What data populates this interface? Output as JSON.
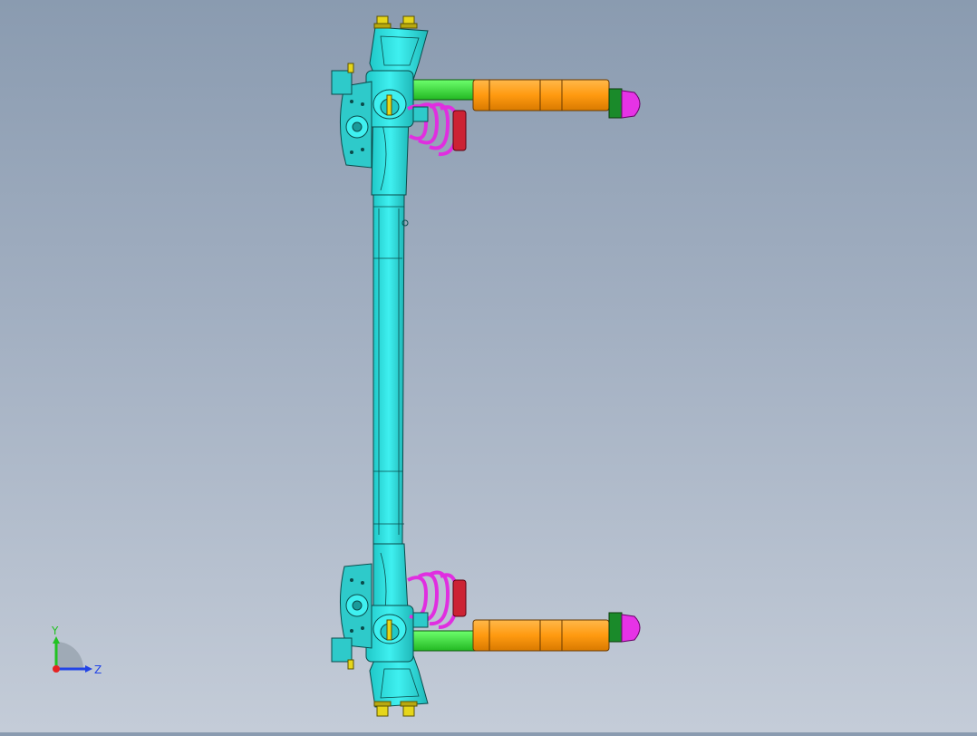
{
  "viewport": {
    "background_top": "#8a9bb0",
    "background_bottom": "#c4ccd8"
  },
  "model": {
    "part_colors": {
      "axle_beam": "#29e6e6",
      "trailing_arm": "#33e633",
      "damper_body": "#ff9e1a",
      "damper_cap": "#e633e6",
      "coil_spring": "#e02ee0",
      "spring_seat": "#cc2233",
      "brake_disc": "#3ad6d6",
      "fasteners": "#e6d61a"
    }
  },
  "triad": {
    "y_label": "Y",
    "z_label": "Z",
    "y_color": "#22c222",
    "z_color": "#2244e6",
    "x_color": "#e62222"
  }
}
